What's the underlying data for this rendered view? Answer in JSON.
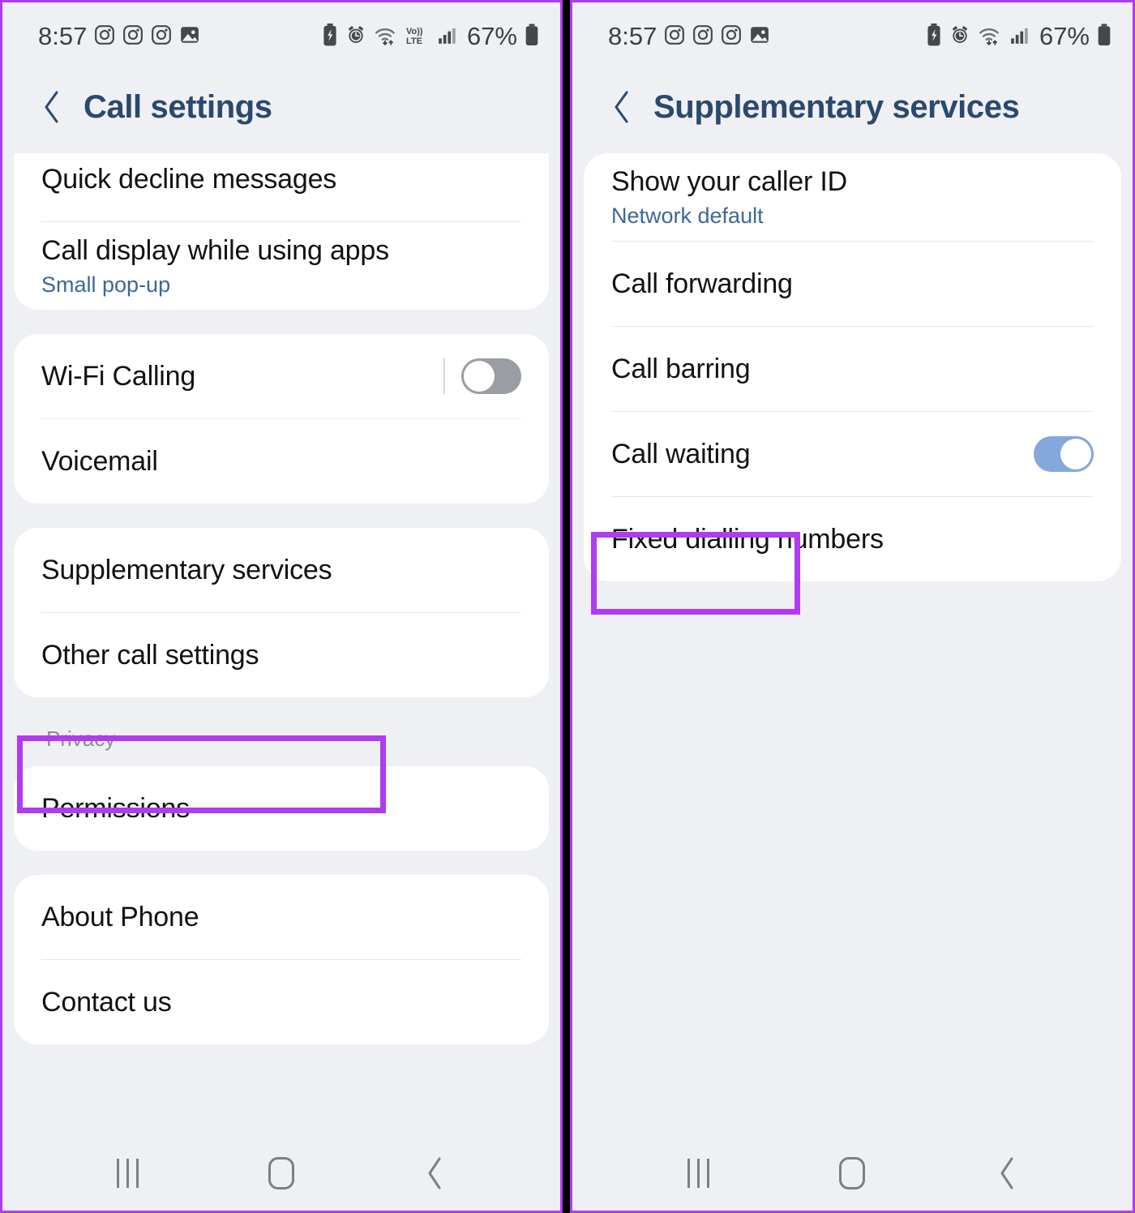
{
  "highlight_color": "#B13BEF",
  "accent_title_color": "#2B496D",
  "subtitle_color": "#3D6898",
  "toggle_on_color": "#84A8DB",
  "toggle_off_color": "#9A9DA4",
  "statusbar": {
    "time": "8:57",
    "battery_percent": "67%",
    "left_icons": [
      "instagram-icon",
      "instagram-icon",
      "instagram-icon",
      "photo-icon"
    ],
    "right_icons_left": [
      "battery-saver-icon",
      "alarm-icon",
      "wifi-icon",
      "volte-icon",
      "signal-icon"
    ],
    "right_icons_right": [
      "battery-saver-icon",
      "alarm-icon",
      "wifi-icon",
      "signal-icon"
    ],
    "volte_label": "Vo))",
    "lte_label": "LTE"
  },
  "navbar": {
    "recents_label": "Recents",
    "home_label": "Home",
    "back_label": "Back"
  },
  "left_panel": {
    "header": {
      "title": "Call settings",
      "back_icon": "chevron-left-icon"
    },
    "cards": [
      {
        "clipped_top": true,
        "rows": [
          {
            "title": "Quick decline messages",
            "sub": "",
            "toggle": null
          },
          {
            "title": "Call display while using apps",
            "sub": "Small pop-up",
            "toggle": null
          }
        ]
      },
      {
        "clipped_top": false,
        "rows": [
          {
            "title": "Wi-Fi Calling",
            "sub": "",
            "toggle": "off"
          },
          {
            "title": "Voicemail",
            "sub": "",
            "toggle": null
          }
        ]
      },
      {
        "clipped_top": false,
        "rows": [
          {
            "title": "Supplementary services",
            "sub": "",
            "toggle": null,
            "highlighted": true
          },
          {
            "title": "Other call settings",
            "sub": "",
            "toggle": null
          }
        ]
      }
    ],
    "group_label": "Privacy",
    "cards_after": [
      {
        "rows": [
          {
            "title": "Permissions",
            "sub": "",
            "toggle": null
          }
        ]
      },
      {
        "rows": [
          {
            "title": "About Phone",
            "sub": "",
            "toggle": null
          },
          {
            "title": "Contact us",
            "sub": "",
            "toggle": null
          }
        ]
      }
    ]
  },
  "right_panel": {
    "header": {
      "title": "Supplementary services",
      "back_icon": "chevron-left-icon"
    },
    "cards": [
      {
        "rows": [
          {
            "title": "Show your caller ID",
            "sub": "Network default",
            "toggle": null
          },
          {
            "title": "Call forwarding",
            "sub": "",
            "toggle": null
          },
          {
            "title": "Call barring",
            "sub": "",
            "toggle": null,
            "highlighted": true
          },
          {
            "title": "Call waiting",
            "sub": "",
            "toggle": "on"
          },
          {
            "title": "Fixed dialling numbers",
            "sub": "",
            "toggle": null
          }
        ]
      }
    ]
  }
}
